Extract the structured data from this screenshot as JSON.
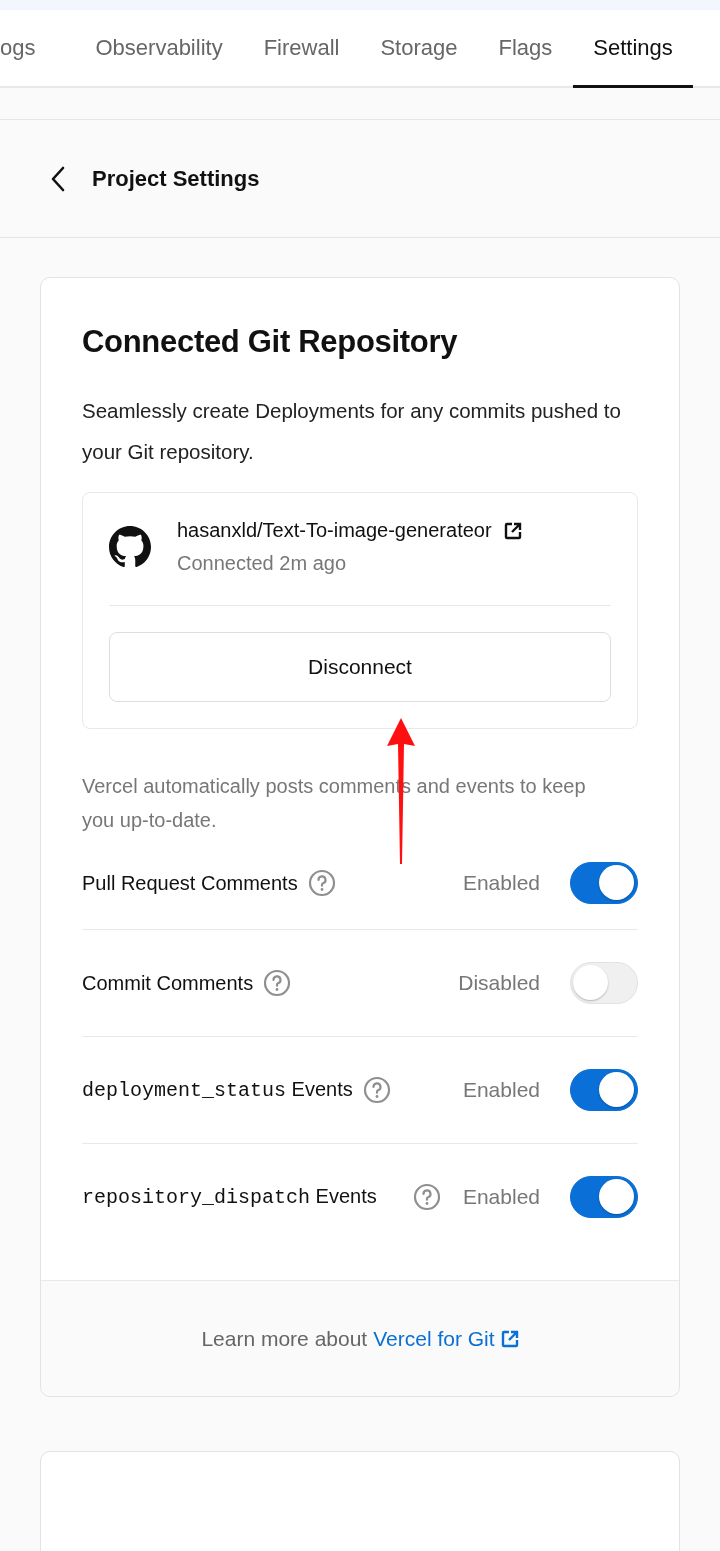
{
  "tabs": [
    {
      "label": "ogs",
      "selected": false
    },
    {
      "label": "Observability",
      "selected": false
    },
    {
      "label": "Firewall",
      "selected": false
    },
    {
      "label": "Storage",
      "selected": false
    },
    {
      "label": "Flags",
      "selected": false
    },
    {
      "label": "Settings",
      "selected": true
    }
  ],
  "header": {
    "title": "Project Settings"
  },
  "git_card": {
    "title": "Connected Git Repository",
    "description": "Seamlessly create Deployments for any commits pushed to your Git repository.",
    "repository": {
      "name": "hasanxld/Text-To-image-generateor",
      "status": "Connected 2m ago",
      "button": "Disconnect"
    },
    "events_note": "Vercel automatically posts comments and events to keep you up-to-date.",
    "settings": [
      {
        "label": "Pull Request Comments",
        "state": "Enabled",
        "on": true
      },
      {
        "label": "Commit Comments",
        "state": "Disabled",
        "on": false
      },
      {
        "code": "deployment_status",
        "label": "Events",
        "state": "Enabled",
        "on": true
      },
      {
        "code": "repository_dispatch",
        "label": "Events",
        "state": "Enabled",
        "on": true
      }
    ],
    "footer": {
      "text": "Learn more about",
      "link": "Vercel for Git"
    }
  }
}
